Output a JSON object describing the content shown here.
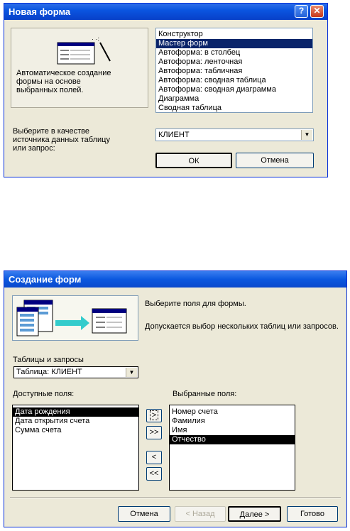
{
  "dialog1": {
    "title": "Новая форма",
    "help_label": "?",
    "close_label": "✕",
    "description": "Автоматическое создание\nформы на основе\nвыбранных полей.",
    "options": [
      "Конструктор",
      "Мастер форм",
      "Автоформа: в столбец",
      "Автоформа: ленточная",
      "Автоформа: табличная",
      "Автоформа:  сводная таблица",
      "Автоформа:  сводная диаграмма",
      "Диаграмма",
      "Сводная таблица"
    ],
    "selected_index": 1,
    "source_label": "Выберите в качестве\nисточника данных таблицу\nили запрос:",
    "source_value": "КЛИЕНТ",
    "ok_label": "ОК",
    "cancel_label": "Отмена"
  },
  "dialog2": {
    "title": "Создание форм",
    "hint1": "Выберите поля для формы.",
    "hint2": "Допускается выбор нескольких таблиц или запросов.",
    "tables_label": "Таблицы и запросы",
    "tables_value": "Таблица: КЛИЕНТ",
    "available_label": "Доступные поля:",
    "available_fields": [
      "Дата рождения",
      "Дата открытия счета",
      "Сумма счета"
    ],
    "available_selected": 0,
    "selected_label": "Выбранные поля:",
    "selected_fields": [
      "Номер счета",
      "Фамилия",
      "Имя",
      "Отчество"
    ],
    "selected_selected": 3,
    "move_one": ">",
    "move_all": ">>",
    "remove_one": "<",
    "remove_all": "<<",
    "cancel_label": "Отмена",
    "back_label": "< Назад",
    "next_label": "Далее >",
    "finish_label": "Готово"
  }
}
